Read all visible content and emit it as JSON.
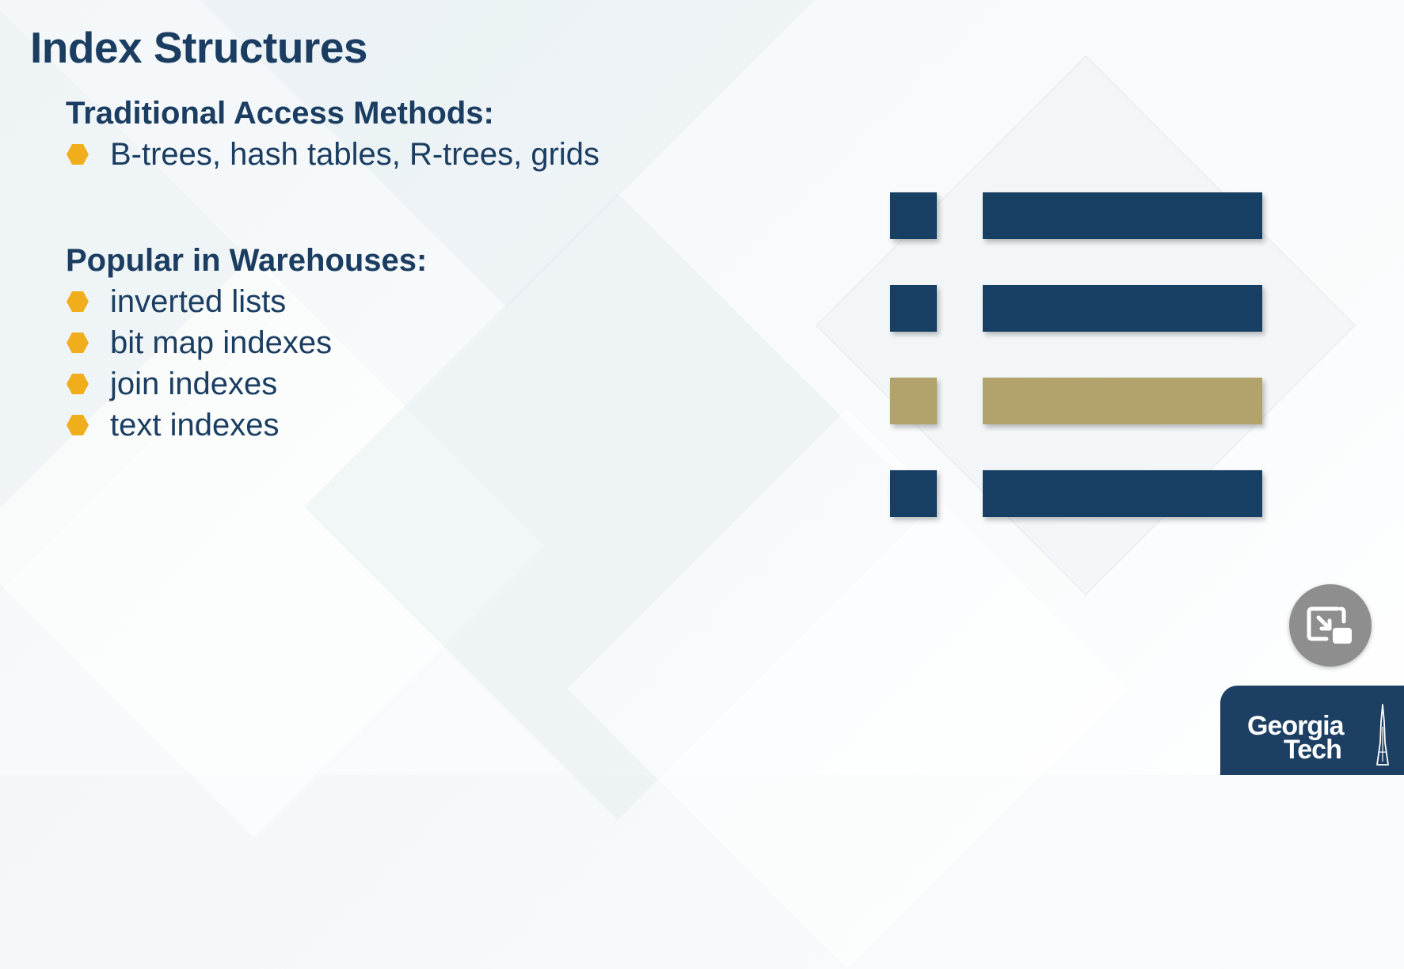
{
  "slide": {
    "title": "Index Structures"
  },
  "sections": [
    {
      "heading": "Traditional Access Methods:",
      "bullets": [
        "B-trees, hash tables, R-trees, grids"
      ]
    },
    {
      "heading": "Popular in Warehouses:",
      "bullets": [
        "inverted lists",
        "bit map indexes",
        "join indexes",
        "text indexes"
      ]
    }
  ],
  "list_graphic": {
    "icon": "list-icon",
    "rows": [
      {
        "color": "#173f63"
      },
      {
        "color": "#173f63"
      },
      {
        "color": "#b1a36b"
      },
      {
        "color": "#173f63"
      }
    ]
  },
  "pip_button": {
    "icon": "exit-picture-in-picture-icon"
  },
  "logo": {
    "line1": "Georgia",
    "line2": "Tech",
    "icon": "tech-tower-icon"
  },
  "colors": {
    "navy": "#1a3d61",
    "bullet_gold": "#f1ae1c",
    "graphic_gold": "#b1a36b",
    "logo_bg": "#1c3f63"
  }
}
